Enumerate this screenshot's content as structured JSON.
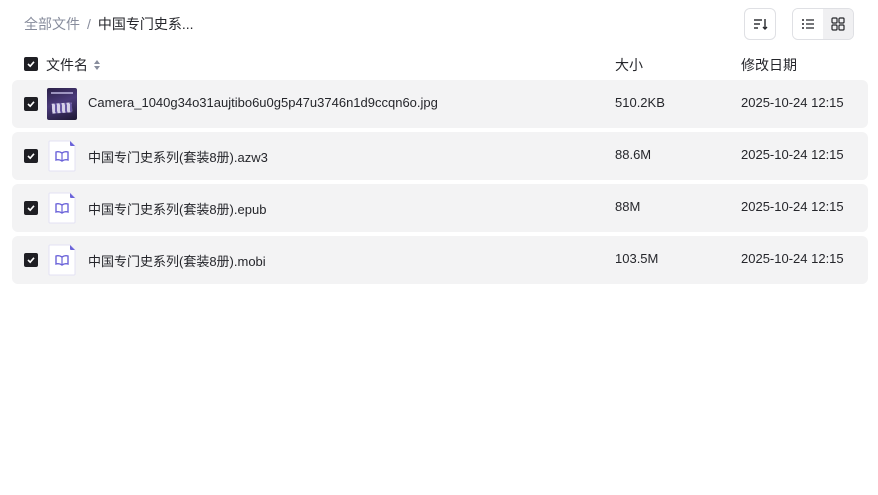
{
  "breadcrumb": {
    "root": "全部文件",
    "separator": "/",
    "current": "中国专门史系..."
  },
  "toolbar": {
    "sort_icon": "sort-icon",
    "list_view_icon": "list-view-icon",
    "grid_view_icon": "grid-view-icon"
  },
  "table": {
    "columns": {
      "name": "文件名",
      "size": "大小",
      "modified": "修改日期"
    },
    "rows": [
      {
        "name": "Camera_1040g34o31aujtibo6u0g5p47u3746n1d9ccqn6o.jpg",
        "size": "510.2KB",
        "modified": "2025-10-24 12:15",
        "icon": "image-thumbnail",
        "selected": true
      },
      {
        "name": "中国专门史系列(套装8册).azw3",
        "size": "88.6M",
        "modified": "2025-10-24 12:15",
        "icon": "ebook-file-icon",
        "selected": true
      },
      {
        "name": "中国专门史系列(套装8册).epub",
        "size": "88M",
        "modified": "2025-10-24 12:15",
        "icon": "ebook-file-icon",
        "selected": true
      },
      {
        "name": "中国专门史系列(套装8册).mobi",
        "size": "103.5M",
        "modified": "2025-10-24 12:15",
        "icon": "ebook-file-icon",
        "selected": true
      }
    ]
  },
  "colors": {
    "row_background": "#f3f3f4",
    "checkbox": "#1f1f24",
    "ebook_icon_accent": "#6b63d9",
    "muted_text": "#878c9c"
  }
}
